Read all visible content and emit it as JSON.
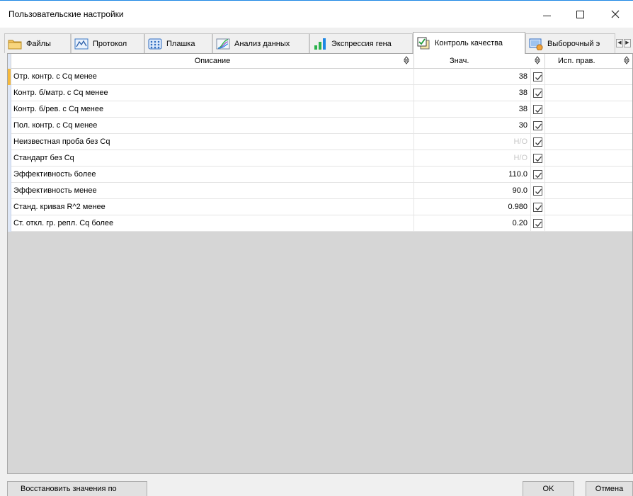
{
  "window": {
    "title": "Пользовательские настройки"
  },
  "tabs": [
    {
      "label": "Файлы",
      "icon": "folder-icon"
    },
    {
      "label": "Протокол",
      "icon": "protocol-curve-icon"
    },
    {
      "label": "Плашка",
      "icon": "plate-grid-icon"
    },
    {
      "label": "Анализ данных",
      "icon": "analysis-curves-icon"
    },
    {
      "label": "Экспрессия гена",
      "icon": "bar-chart-icon"
    },
    {
      "label": "Контроль качества",
      "icon": "quality-control-icon",
      "active": true
    },
    {
      "label": "Выборочный э",
      "icon": "sample-icon"
    }
  ],
  "grid": {
    "columns": {
      "description": "Описание",
      "value": "Знач.",
      "use_rule": "Исп. прав."
    },
    "rows": [
      {
        "description": "Отр. контр. с Cq менее",
        "value": "38",
        "checked": true
      },
      {
        "description": "Контр. б/матр. с Cq менее",
        "value": "38",
        "checked": true
      },
      {
        "description": "Контр. б/рев. с Cq менее",
        "value": "38",
        "checked": true
      },
      {
        "description": "Пол. контр. с Cq менее",
        "value": "30",
        "checked": true
      },
      {
        "description": "Неизвестная проба без Cq",
        "value": "Н/О",
        "checked": true,
        "disabled": true
      },
      {
        "description": "Стандарт без Cq",
        "value": "Н/О",
        "checked": true,
        "disabled": true
      },
      {
        "description": "Эффективность более",
        "value": "110.0",
        "checked": true
      },
      {
        "description": "Эффективность менее",
        "value": "90.0",
        "checked": true
      },
      {
        "description": "Станд. кривая R^2 менее",
        "value": "0.980",
        "checked": true
      },
      {
        "description": "Ст. откл. гр. репл. Cq более",
        "value": "0.20",
        "checked": true
      }
    ]
  },
  "buttons": {
    "restore": "Восстановить значения по",
    "ok": "OK",
    "cancel": "Отмена"
  },
  "colors": {
    "accent": "#1e88e5",
    "active_row_marker": "#f6b93b",
    "grid_empty_area": "#d6d6d6"
  }
}
